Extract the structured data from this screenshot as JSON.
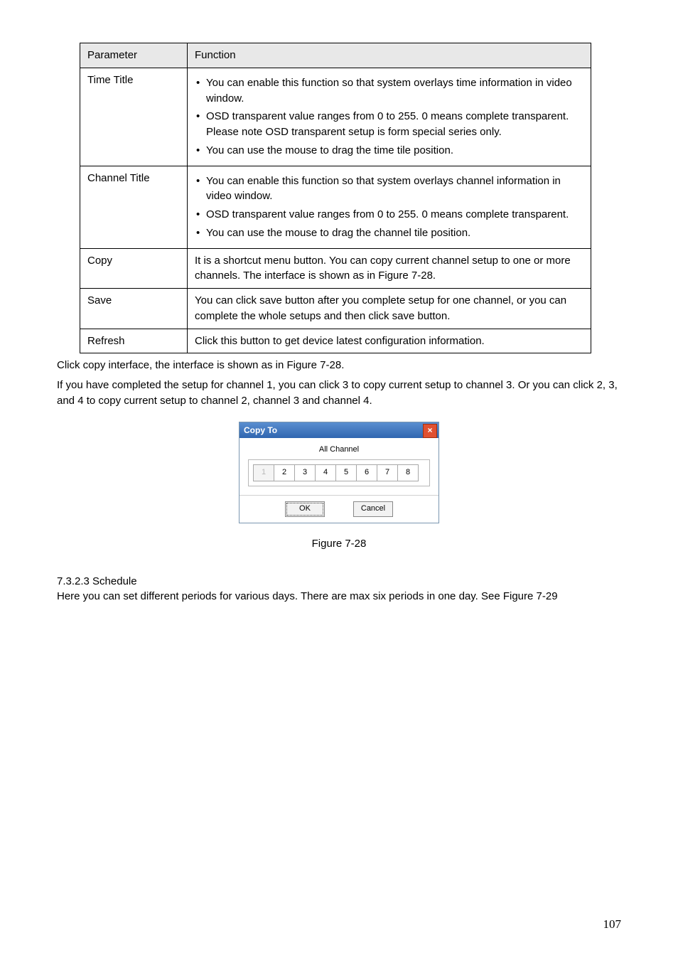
{
  "tableHeader": {
    "c1": "Parameter",
    "c2": "Function"
  },
  "rows": {
    "timeTitle": {
      "param": "Time Title",
      "b1": "You can enable this function so that system overlays time information in video window.",
      "b2": "OSD transparent value ranges from 0 to 255. 0 means complete transparent. Please note OSD transparent setup is form special series only.",
      "b3": "You can use the mouse to drag the time tile position."
    },
    "channelTitle": {
      "param": "Channel Title",
      "b1": "You can enable this function so that system overlays channel information in video window.",
      "b2": "OSD transparent value ranges from 0 to 255. 0 means complete transparent.",
      "b3": "You can use the mouse to drag the channel tile position."
    },
    "copy": {
      "param": "Copy",
      "text": "It is a shortcut menu button. You can copy current channel setup to one or more channels.  The interface is shown as in Figure 7-28."
    },
    "save": {
      "param": "Save",
      "text": "You can click save button after you complete setup for one channel, or you can complete the whole setups and then click save button."
    },
    "refresh": {
      "param": "Refresh",
      "text": "Click this button to get device latest configuration information."
    }
  },
  "para1": "Click copy interface, the interface is shown as in Figure 7-28.",
  "para2": "If you have completed the setup for channel 1, you can click 3 to copy current setup to channel 3. Or you can click 2, 3, and 4 to copy current setup to channel 2, channel 3 and channel 4.",
  "dialog": {
    "title": "Copy To",
    "closeGlyph": "×",
    "allChannel": "All Channel",
    "channels": {
      "c1": "1",
      "c2": "2",
      "c3": "3",
      "c4": "4",
      "c5": "5",
      "c6": "6",
      "c7": "7",
      "c8": "8"
    },
    "ok": "OK",
    "cancel": "Cancel"
  },
  "figCaption": "Figure 7-28",
  "section": {
    "num": "7.3.2.3  Schedule",
    "text": "Here you can set different periods for various days. There are max six periods in one day. See Figure 7-29"
  },
  "pageNumber": "107"
}
